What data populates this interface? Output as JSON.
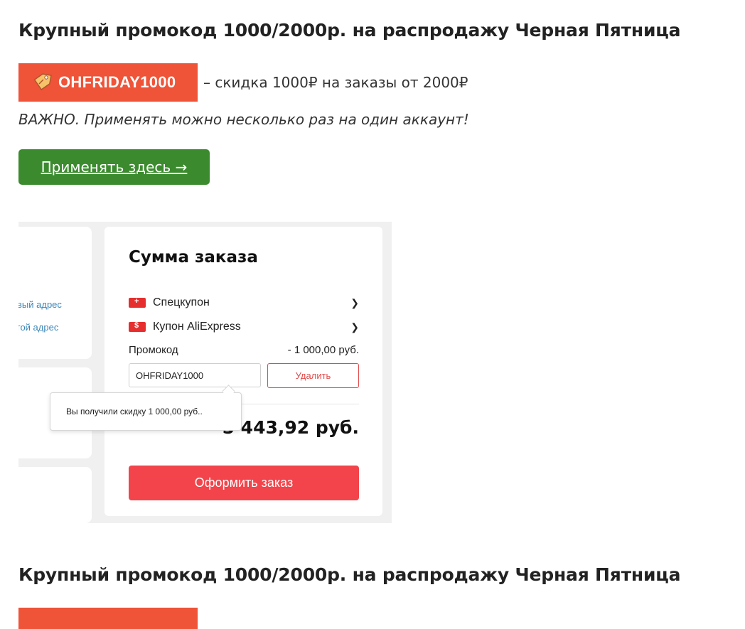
{
  "article": {
    "heading": "Крупный промокод 1000/2000р. на распродажу Черная Пятница",
    "promo_code": "OHFRIDAY1000",
    "promo_description": "– скидка 1000₽ на заказы от 2000₽",
    "note": "ВАЖНО. Применять можно несколько раз на один аккаунт!",
    "apply_button": "Применять здесь →",
    "heading_2": "Крупный промокод 1000/2000р. на распродажу Черная Пятница"
  },
  "screenshot": {
    "left_links": [
      "вый адрес",
      "гой адрес"
    ],
    "title": "Сумма заказа",
    "coupon_rows": [
      {
        "label": "Спецкупон",
        "icon": "+"
      },
      {
        "label": "Купон AliExpress",
        "icon": "$"
      }
    ],
    "promo_label": "Промокод",
    "promo_discount": "- 1 000,00 руб.",
    "promo_input_value": "OHFRIDAY1000",
    "delete_button": "Удалить",
    "tooltip": "Вы получили скидку 1 000,00 руб..",
    "total": "5 443,92 руб.",
    "order_button": "Оформить заказ"
  },
  "colors": {
    "promo_badge": "#ef5338",
    "apply_button": "#3b8b2e",
    "order_button": "#f2444a"
  }
}
